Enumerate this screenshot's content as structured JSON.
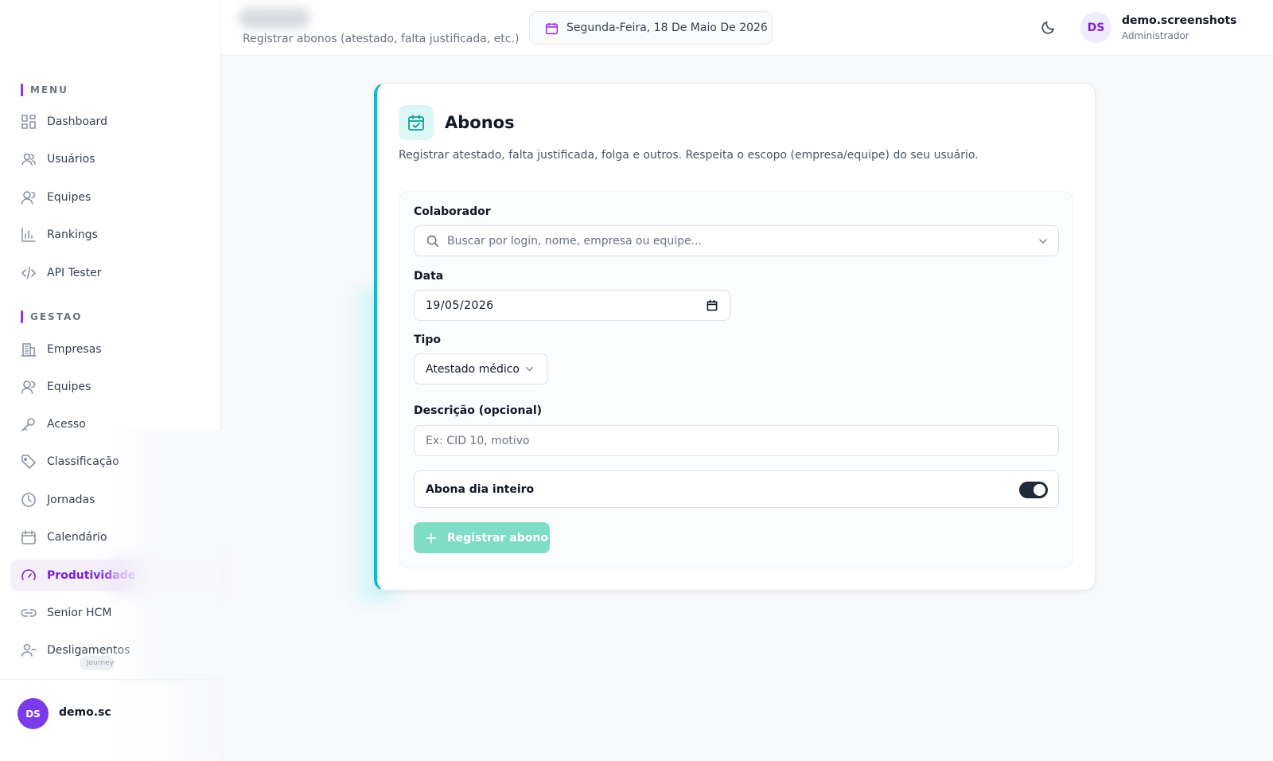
{
  "header": {
    "subtitle": "Registrar abonos (atestado, falta justificada, etc.)",
    "date": "Segunda-Feira, 18 De Maio De 2026",
    "user": {
      "initials": "DS",
      "name": "demo.screenshots",
      "role": "Administrador"
    }
  },
  "sidebar": {
    "menu_title": "MENU",
    "menu_items": [
      {
        "label": "Dashboard",
        "icon": "dashboard-icon"
      },
      {
        "label": "Usuários",
        "icon": "users-icon"
      },
      {
        "label": "Equipes",
        "icon": "team-icon"
      },
      {
        "label": "Rankings",
        "icon": "bar-chart-icon"
      },
      {
        "label": "API Tester",
        "icon": "code-icon"
      }
    ],
    "gestao_title": "GESTAO",
    "gestao_items": [
      {
        "label": "Empresas",
        "icon": "building-icon"
      },
      {
        "label": "Equipes",
        "icon": "team-icon"
      },
      {
        "label": "Acesso",
        "icon": "key-icon"
      },
      {
        "label": "Classificação",
        "icon": "tag-icon"
      },
      {
        "label": "Jornadas",
        "icon": "clock-icon"
      },
      {
        "label": "Calendário",
        "icon": "calendar-icon"
      },
      {
        "label": "Produtividade",
        "icon": "gauge-icon",
        "active": true
      },
      {
        "label": "Senior HCM",
        "icon": "link-icon"
      },
      {
        "label": "Desligamentos",
        "icon": "user-minus-icon"
      }
    ],
    "journey_badge": "Journey",
    "footer": {
      "initials": "DS",
      "name": "demo.screenshots"
    }
  },
  "card": {
    "title": "Abonos",
    "description": "Registrar atestado, falta justificada, folga e outros. Respeita o escopo (empresa/equipe) do seu usuário.",
    "colaborador": {
      "label": "Colaborador",
      "placeholder": "Buscar por login, nome, empresa ou equipe..."
    },
    "data": {
      "label": "Data",
      "value": "19/05/2026"
    },
    "tipo": {
      "label": "Tipo",
      "value": "Atestado médico"
    },
    "descricao": {
      "label": "Descrição (opcional)",
      "placeholder": "Ex: CID 10, motivo"
    },
    "abona": {
      "label": "Abona dia inteiro",
      "checked": true
    },
    "submit": "Registrar abono"
  },
  "colors": {
    "accent": "#9333ea",
    "teal": "#14b8c6",
    "submit": "#7fdcc6"
  }
}
